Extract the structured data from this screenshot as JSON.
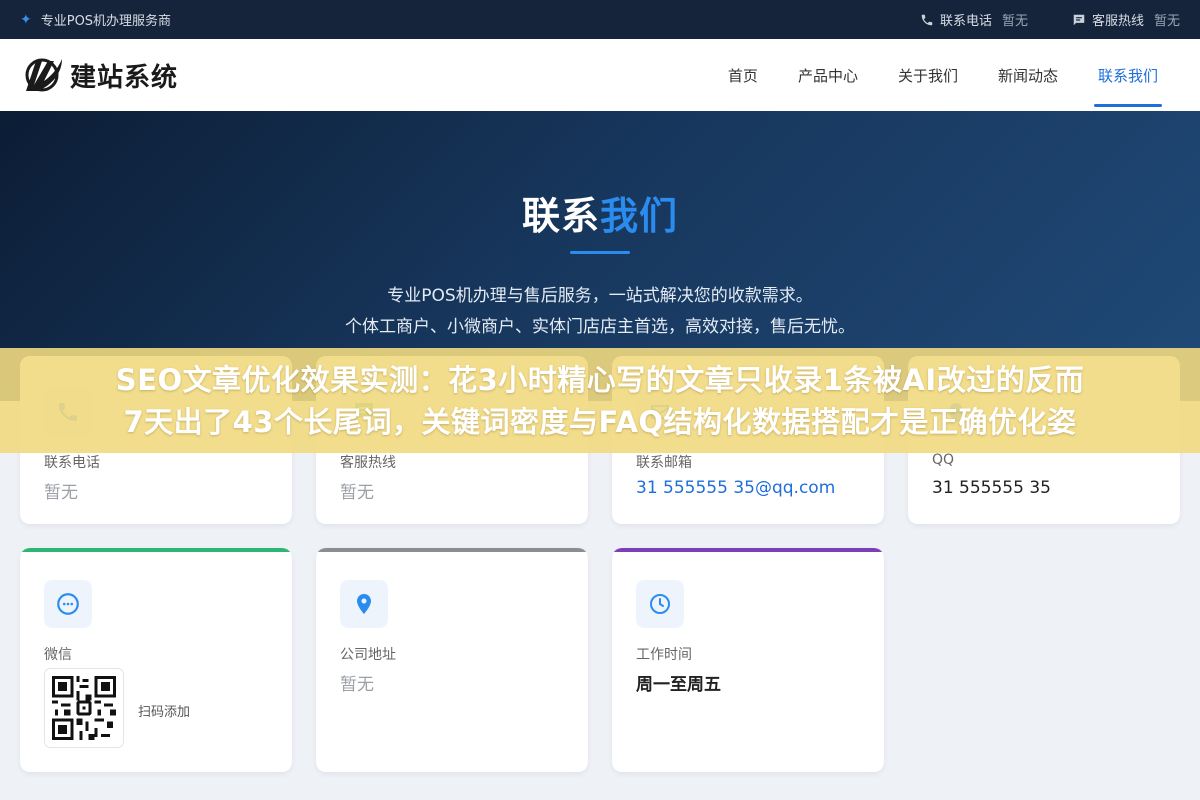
{
  "topbar": {
    "site_name": "专业POS机办理服务商",
    "phone_label": "联系电话",
    "phone_value": "暂无",
    "hotline_label": "客服热线",
    "hotline_value": "暂无"
  },
  "header": {
    "logo_text": "建站系统",
    "nav": [
      {
        "label": "首页",
        "active": false
      },
      {
        "label": "产品中心",
        "active": false
      },
      {
        "label": "关于我们",
        "active": false
      },
      {
        "label": "新闻动态",
        "active": false
      },
      {
        "label": "联系我们",
        "active": true
      }
    ]
  },
  "hero": {
    "title_part1": "联系",
    "title_part2": "我们",
    "subtitle_line1": "专业POS机办理与售后服务，一站式解决您的收款需求。",
    "subtitle_line2": "个体工商户、小微商户、实体门店店主首选，高效对接，售后无忧。"
  },
  "cards_row1": [
    {
      "label": "联系电话",
      "value": "暂无",
      "icon": "phone-icon"
    },
    {
      "label": "客服热线",
      "value": "暂无",
      "icon": "chat-icon"
    },
    {
      "label": "联系邮箱",
      "value": "31 555555 35@qq.com",
      "icon": "mail-icon"
    },
    {
      "label": "QQ",
      "value": "31 555555 35",
      "icon": "qq-icon"
    }
  ],
  "cards_row2": [
    {
      "label": "微信",
      "qr_label": "扫码添加",
      "icon": "wechat-icon",
      "accent": "#2bb673"
    },
    {
      "label": "公司地址",
      "value": "暂无",
      "icon": "location-pin-icon",
      "accent": "#8a8d93"
    },
    {
      "label": "工作时间",
      "value": "周一至周五",
      "icon": "clock-icon",
      "accent": "#7b3fb8"
    }
  ],
  "banner": {
    "line1": "SEO文章优化效果实测：花3小时精心写的文章只收录1条被AI改过的反而",
    "line2": "7天出了43个长尾词，关键词密度与FAQ结构化数据搭配才是正确优化姿"
  },
  "colors": {
    "primary": "#1e6fd9",
    "topbar_bg": "#15243a",
    "banner_bg": "#f1d980"
  }
}
